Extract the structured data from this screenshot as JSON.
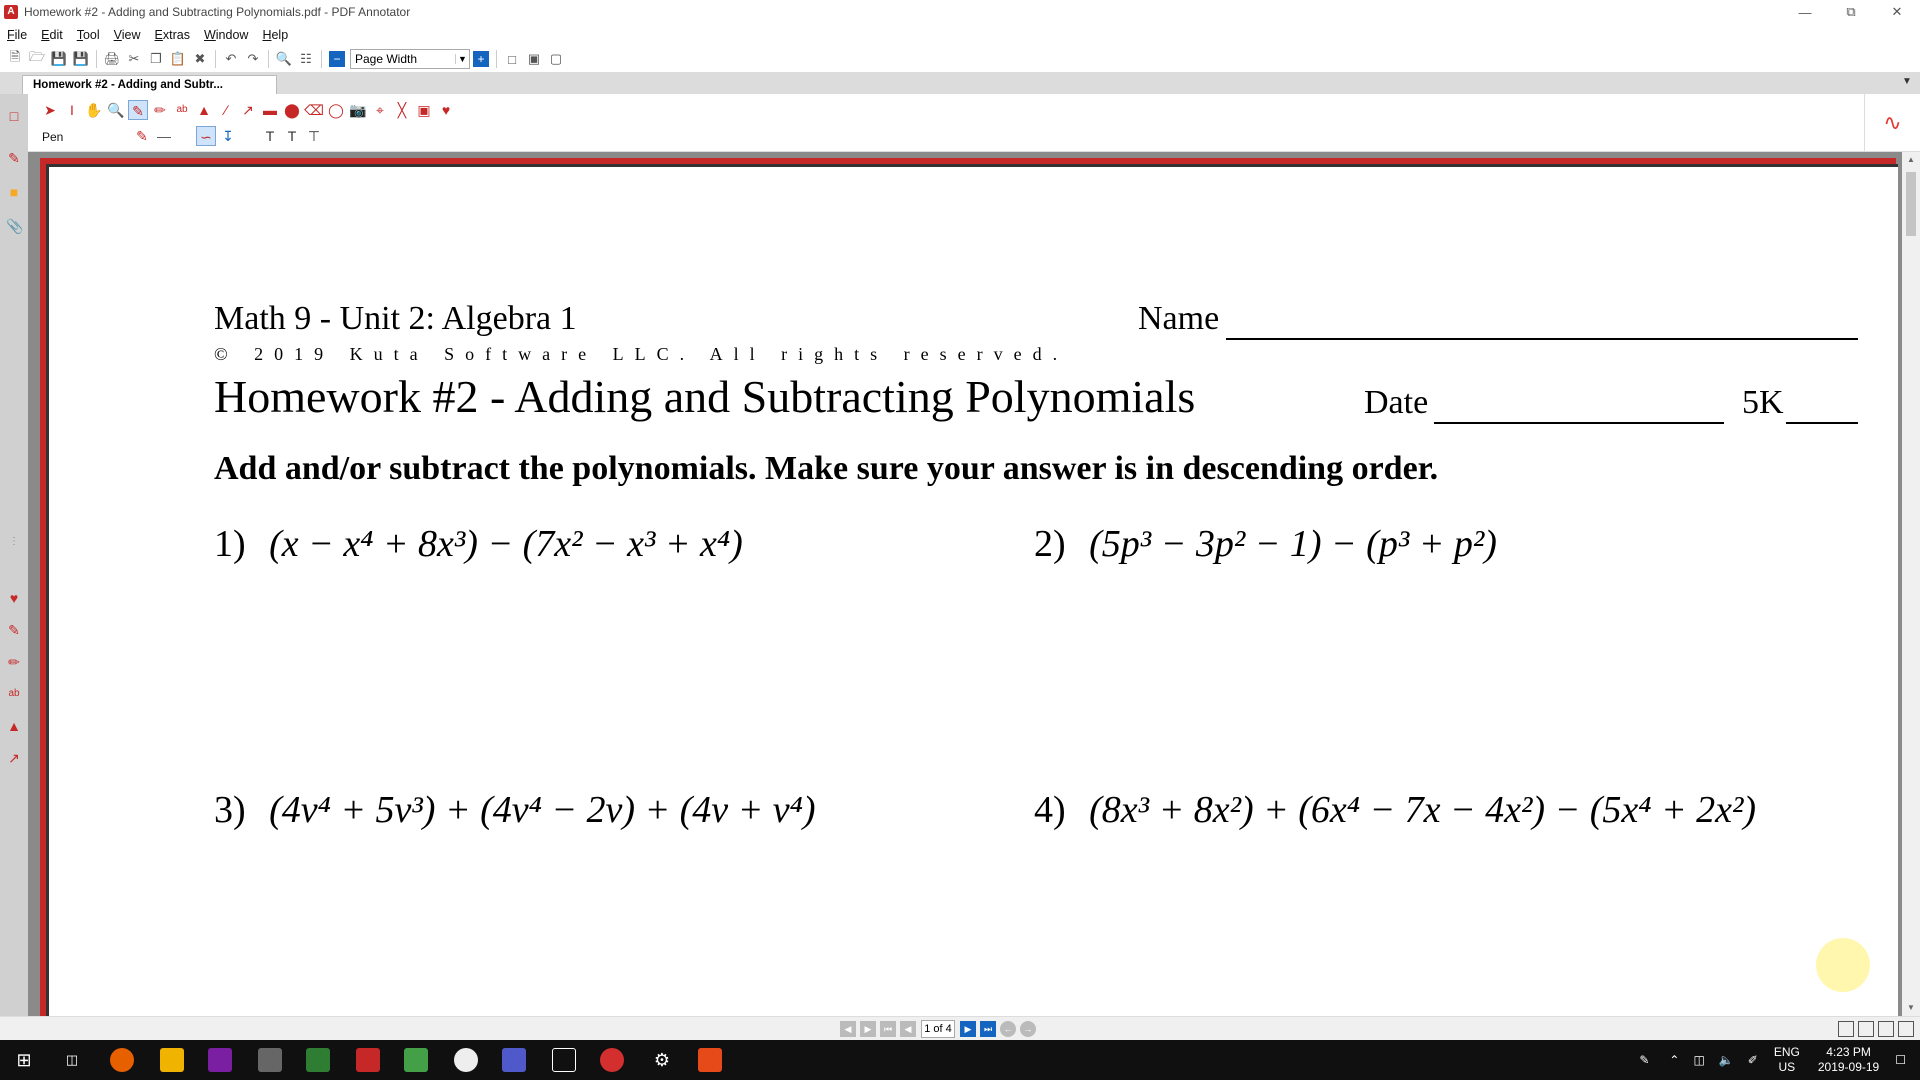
{
  "window": {
    "title": "Homework #2 - Adding and Subtracting Polynomials.pdf - PDF Annotator",
    "controls": [
      "minimize",
      "restore",
      "close"
    ]
  },
  "menu": [
    "File",
    "Edit",
    "Tool",
    "View",
    "Extras",
    "Window",
    "Help"
  ],
  "toolbar": {
    "zoom_value": "Page Width"
  },
  "tab": {
    "label": "Homework #2 - Adding and Subtr..."
  },
  "annotation_toolbar": {
    "current_tool": "Pen"
  },
  "worksheet": {
    "course": "Math 9 - Unit 2: Algebra 1",
    "name_label": "Name",
    "copyright": "© 2019 Kuta Software LLC. All rights reserved.",
    "title": "Homework #2 - Adding and Subtracting Polynomials",
    "date_label": "Date",
    "period_label": "5K",
    "instructions": "Add and/or subtract the polynomials. Make sure your answer is in descending order.",
    "problems": [
      {
        "number": "1)",
        "expression": "(x − x⁴ + 8x³) − (7x² − x³ + x⁴)"
      },
      {
        "number": "2)",
        "expression": "(5p³ − 3p² − 1) − (p³ + p²)"
      },
      {
        "number": "3)",
        "expression": "(4v⁴ + 5v³) + (4v⁴ − 2v) + (4v + v⁴)"
      },
      {
        "number": "4)",
        "expression": "(8x³ + 8x²) + (6x⁴ − 7x − 4x²) − (5x⁴ + 2x²)"
      }
    ]
  },
  "status": {
    "page_indicator": "1 of 4"
  },
  "taskbar": {
    "language": "ENG",
    "region": "US",
    "time": "4:23 PM",
    "date": "2019-09-19"
  },
  "colors": {
    "accent": "#c62828",
    "toolbar_blue": "#1565c0",
    "taskbar": "#101010"
  }
}
